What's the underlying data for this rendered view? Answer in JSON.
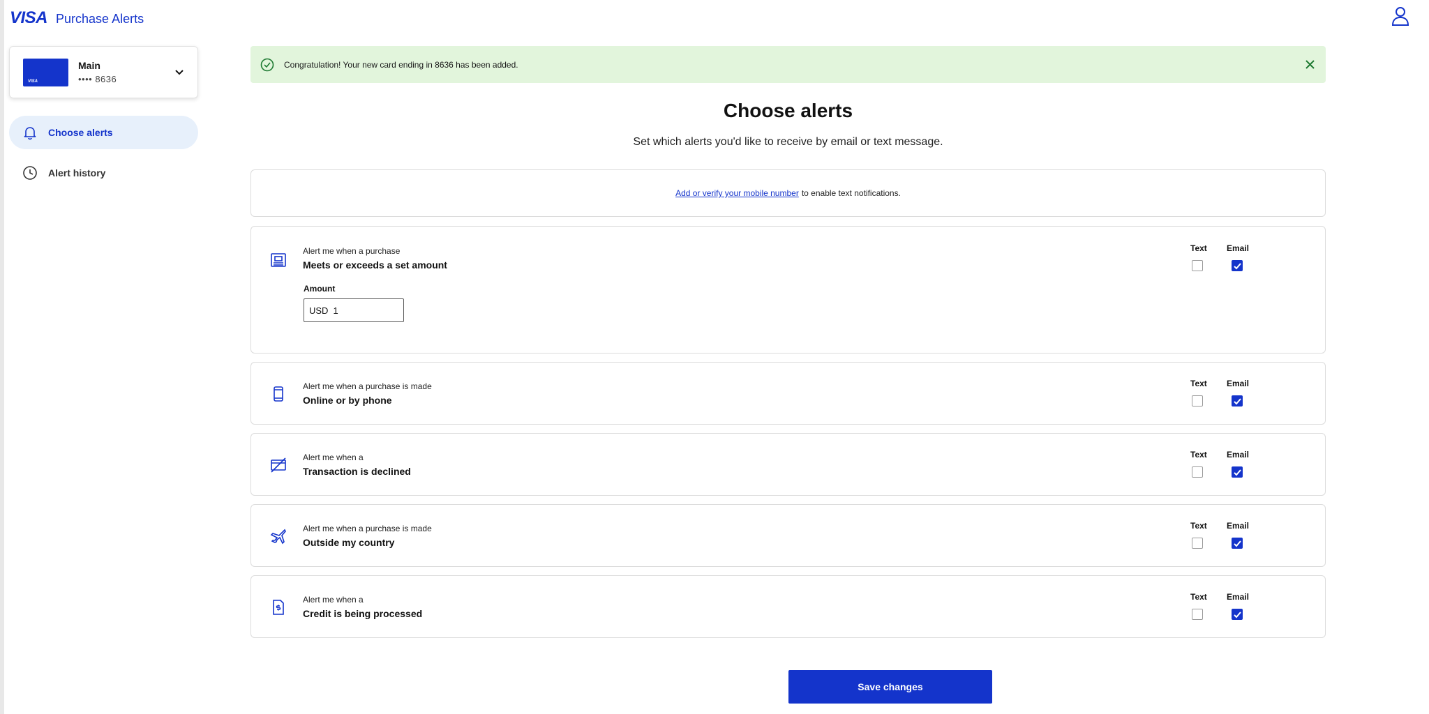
{
  "header": {
    "logo": "VISA",
    "title": "Purchase Alerts",
    "user_icon": "user-icon"
  },
  "card": {
    "name": "Main",
    "number": "•••• 8636",
    "thumb_mark": "VISA",
    "color": "#1434cb"
  },
  "sidebar": {
    "items": [
      {
        "label": "Choose alerts",
        "icon": "bell-icon",
        "active": true
      },
      {
        "label": "Alert history",
        "icon": "clock-icon",
        "active": false
      }
    ]
  },
  "banner": {
    "message": "Congratulation! Your new card ending in 8636 has been added.",
    "color": "#e2f5dc"
  },
  "main": {
    "title": "Choose alerts",
    "subtitle": "Set which alerts you'd like to receive by email or text message.",
    "mobile_link": "Add or verify your mobile number",
    "mobile_suffix": "to enable text notifications."
  },
  "columns": {
    "text": "Text",
    "email": "Email"
  },
  "alerts": [
    {
      "pre": "Alert me when a purchase",
      "main": "Meets or exceeds a set amount",
      "icon": "receipt-icon",
      "text": false,
      "email": true,
      "amount": {
        "label": "Amount",
        "currency": "USD",
        "value": "1"
      }
    },
    {
      "pre": "Alert me when a purchase is made",
      "main": "Online or by phone",
      "icon": "phone-icon",
      "text": false,
      "email": true
    },
    {
      "pre": "Alert me when a",
      "main": "Transaction is declined",
      "icon": "card-declined-icon",
      "text": false,
      "email": true
    },
    {
      "pre": "Alert me when a purchase is made",
      "main": "Outside my country",
      "icon": "airplane-icon",
      "text": false,
      "email": true
    },
    {
      "pre": "Alert me when a",
      "main": "Credit is being processed",
      "icon": "credit-doc-icon",
      "text": false,
      "email": true
    }
  ],
  "footer": {
    "save_label": "Save changes"
  },
  "colors": {
    "brand": "#1434cb",
    "active_nav": "#e7f0fb"
  }
}
